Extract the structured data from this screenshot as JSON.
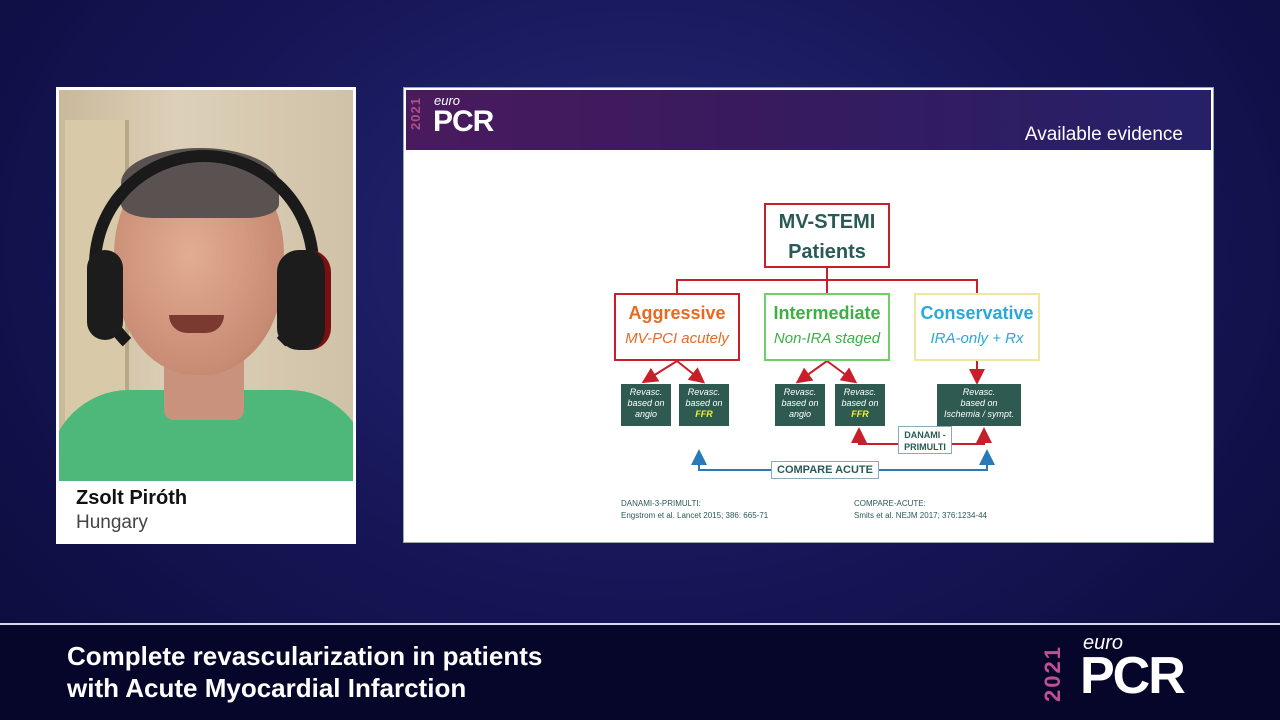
{
  "speaker": {
    "name": "Zsolt Piróth",
    "country": "Hungary"
  },
  "slide": {
    "brand": {
      "year": "2021",
      "euro": "euro",
      "pcr": "PCR"
    },
    "title": "Available evidence",
    "root": [
      "MV-STEMI",
      "Patients"
    ],
    "strategies": [
      {
        "title": "Aggressive",
        "subtitle": "MV-PCI acutely",
        "color": "#e86a20"
      },
      {
        "title": "Intermediate",
        "subtitle": "Non-IRA staged",
        "color": "#3fae45"
      },
      {
        "title": "Conservative",
        "subtitle": "IRA-only + Rx",
        "color": "#2aa8d8"
      }
    ],
    "revasc": [
      {
        "line1": "Revasc.",
        "line2": "based on",
        "line3": "angio",
        "ffr": false
      },
      {
        "line1": "Revasc.",
        "line2": "based on",
        "line3": "FFR",
        "ffr": true
      },
      {
        "line1": "Revasc.",
        "line2": "based on",
        "line3": "angio",
        "ffr": false
      },
      {
        "line1": "Revasc.",
        "line2": "based on",
        "line3": "FFR",
        "ffr": true
      },
      {
        "line1": "Revasc.",
        "line2": "based on",
        "line3": "Ischemia / sympt.",
        "ffr": false
      }
    ],
    "trials": {
      "danami_line1": "DANAMI -",
      "danami_line2": "PRIMULTI",
      "compare": "COMPARE ACUTE"
    },
    "references": [
      {
        "line1": "DANAMI-3-PRIMULTI:",
        "line2": "Engstrom et al. Lancet 2015; 386: 665-71"
      },
      {
        "line1": "COMPARE-ACUTE:",
        "line2": "Smits et al. NEJM 2017; 376:1234-44"
      }
    ]
  },
  "footer": {
    "title_line1": "Complete revascularization in patients",
    "title_line2": "with Acute Myocardial Infarction",
    "brand": {
      "year": "2021",
      "euro": "euro",
      "pcr": "PCR"
    }
  },
  "colors": {
    "accent_red": "#c8202a",
    "teal_box": "#2e5a52",
    "ffr_yellow": "#f2f23a",
    "brand_pink": "#c05090"
  }
}
